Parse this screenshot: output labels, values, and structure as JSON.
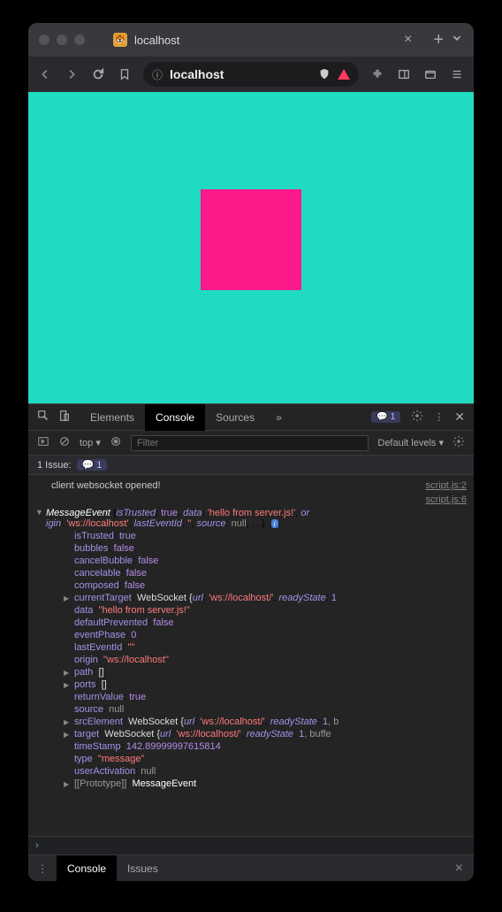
{
  "tab": {
    "title": "localhost"
  },
  "url": {
    "text": "localhost"
  },
  "devtools": {
    "tabs": {
      "elements": "Elements",
      "console": "Console",
      "sources": "Sources"
    },
    "message_count": "1",
    "subbar": {
      "context": "top",
      "filter_placeholder": "Filter",
      "levels": "Default levels"
    },
    "issue_bar": {
      "label": "1 Issue:",
      "count": "1"
    },
    "drawer": {
      "console": "Console",
      "issues": "Issues"
    }
  },
  "console": {
    "log1_text": "client websocket opened!",
    "log1_src": "script.js:2",
    "log2_src": "script.js:6",
    "header_prefix": "MessageEvent ",
    "header_kv": [
      {
        "k": "isTrusted",
        "v": "true",
        "t": "true"
      },
      {
        "k": "data",
        "v": "'hello from server.js!'",
        "t": "str"
      }
    ],
    "header_tail_k1": "or\nigin",
    "header_tail_v1": "'ws://localhost'",
    "header_tail_k2": "lastEventId",
    "header_tail_v2": "''",
    "header_tail_k3": "source",
    "header_tail_v3": "null",
    "props": [
      {
        "k": "isTrusted",
        "v": "true",
        "t": "true"
      },
      {
        "k": "bubbles",
        "v": "false",
        "t": "false"
      },
      {
        "k": "cancelBubble",
        "v": "false",
        "t": "false"
      },
      {
        "k": "cancelable",
        "v": "false",
        "t": "false"
      },
      {
        "k": "composed",
        "v": "false",
        "t": "false"
      },
      {
        "k": "currentTarget",
        "v": "WebSocket {",
        "rest": "url: 'ws://localhost/', readyState: 1",
        "t": "obj",
        "arrow": true
      },
      {
        "k": "data",
        "v": "\"hello from server.js!\"",
        "t": "str"
      },
      {
        "k": "defaultPrevented",
        "v": "false",
        "t": "false"
      },
      {
        "k": "eventPhase",
        "v": "0",
        "t": "num"
      },
      {
        "k": "lastEventId",
        "v": "\"\"",
        "t": "str"
      },
      {
        "k": "origin",
        "v": "\"ws://localhost\"",
        "t": "str"
      },
      {
        "k": "path",
        "v": "[]",
        "t": "obj",
        "arrow": true
      },
      {
        "k": "ports",
        "v": "[]",
        "t": "obj",
        "arrow": true
      },
      {
        "k": "returnValue",
        "v": "true",
        "t": "true"
      },
      {
        "k": "source",
        "v": "null",
        "t": "null"
      },
      {
        "k": "srcElement",
        "v": "WebSocket {",
        "rest": "url: 'ws://localhost/', readyState: 1, b",
        "t": "obj",
        "arrow": true
      },
      {
        "k": "target",
        "v": "WebSocket {",
        "rest": "url: 'ws://localhost/', readyState: 1, buffe",
        "t": "obj",
        "arrow": true
      },
      {
        "k": "timeStamp",
        "v": "142.89999997615814",
        "t": "num"
      },
      {
        "k": "type",
        "v": "\"message\"",
        "t": "str"
      },
      {
        "k": "userActivation",
        "v": "null",
        "t": "null"
      },
      {
        "k": "[[Prototype]]",
        "v": "MessageEvent",
        "t": "proto",
        "arrow": true
      }
    ]
  }
}
